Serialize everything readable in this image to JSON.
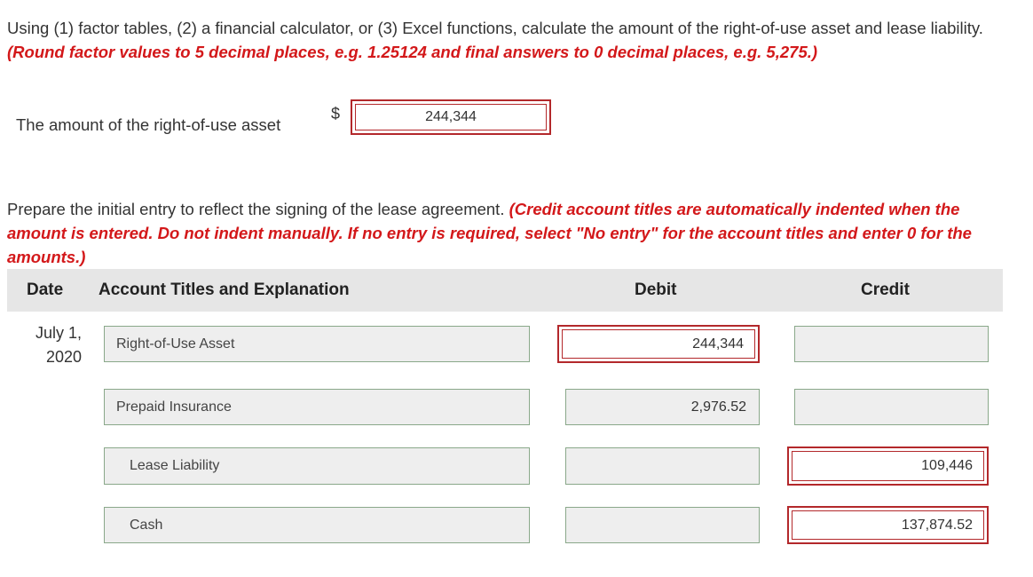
{
  "instructions": {
    "text": "Using (1) factor tables, (2) a financial calculator, or (3) Excel functions, calculate the amount of the right-of-use asset and lease liability.",
    "rounding_note": "(Round factor values to 5 decimal places, e.g. 1.25124 and final answers to 0 decimal places, e.g. 5,275.)"
  },
  "asset_question": {
    "label": "The amount of the right-of-use asset",
    "currency": "$",
    "value": "244,344"
  },
  "journal_prompt": {
    "text": "Prepare the initial entry to reflect the signing of the lease agreement.",
    "note": "(Credit account titles are automatically indented when the amount is entered. Do not indent manually. If no entry is required, select \"No entry\" for the account titles and enter 0 for the amounts.)"
  },
  "table": {
    "headers": {
      "date": "Date",
      "account": "Account Titles and Explanation",
      "debit": "Debit",
      "credit": "Credit"
    },
    "date_line1": "July 1,",
    "date_line2": "2020",
    "rows": [
      {
        "account": "Right-of-Use Asset",
        "debit": "244,344",
        "credit": ""
      },
      {
        "account": "Prepaid Insurance",
        "debit": "2,976.52",
        "credit": ""
      },
      {
        "account": "Lease Liability",
        "debit": "",
        "credit": "109,446"
      },
      {
        "account": "Cash",
        "debit": "",
        "credit": "137,874.52"
      }
    ]
  },
  "colors": {
    "accent_red": "#d3181a",
    "error_border": "#b3282b",
    "header_bg": "#e6e6e6"
  }
}
